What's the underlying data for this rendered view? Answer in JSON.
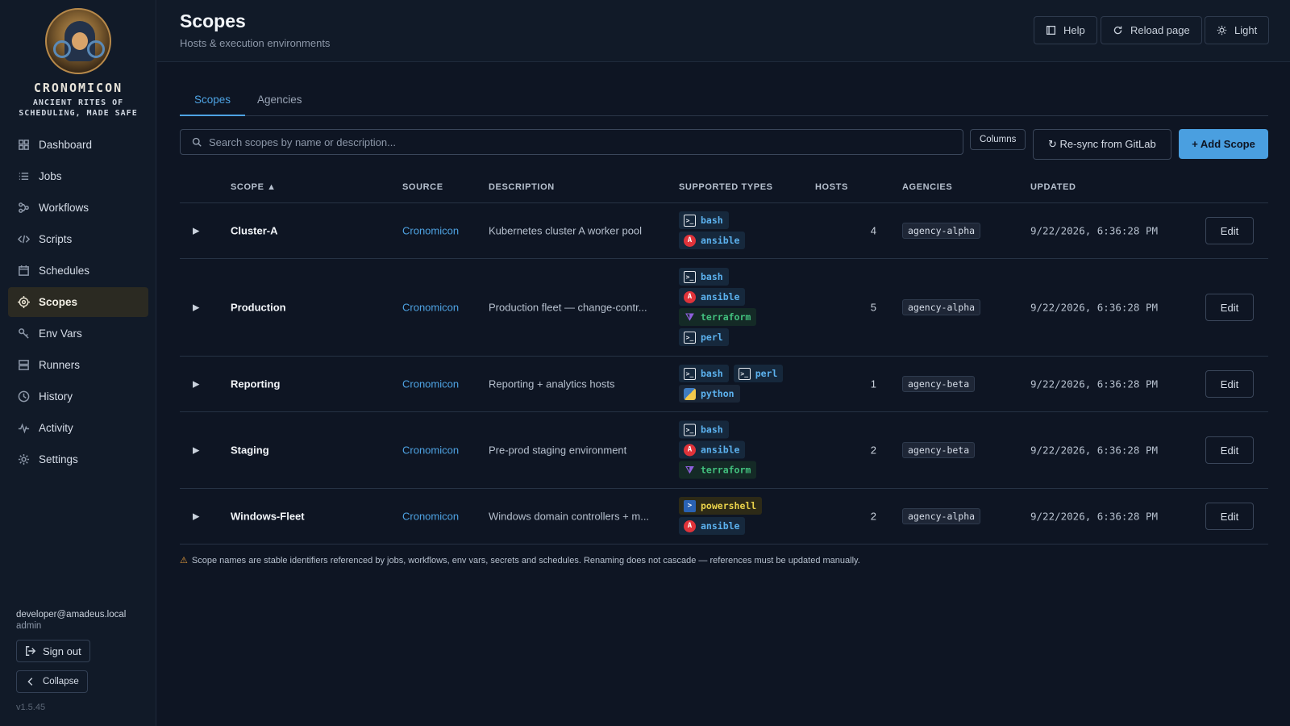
{
  "app": {
    "name": "CRONOMICON",
    "tagline": "ANCIENT RITES OF SCHEDULING, MADE SAFE",
    "version": "v1.5.45"
  },
  "sidebar": {
    "items": [
      {
        "label": "Dashboard",
        "icon": "dashboard-icon"
      },
      {
        "label": "Jobs",
        "icon": "list-icon"
      },
      {
        "label": "Workflows",
        "icon": "workflow-icon"
      },
      {
        "label": "Scripts",
        "icon": "code-icon"
      },
      {
        "label": "Schedules",
        "icon": "calendar-icon"
      },
      {
        "label": "Scopes",
        "icon": "target-icon",
        "active": true
      },
      {
        "label": "Env Vars",
        "icon": "key-icon"
      },
      {
        "label": "Runners",
        "icon": "server-icon"
      },
      {
        "label": "History",
        "icon": "clock-icon"
      },
      {
        "label": "Activity",
        "icon": "pulse-icon"
      },
      {
        "label": "Settings",
        "icon": "gear-icon"
      }
    ],
    "user_email": "developer@amadeus.local",
    "user_role": "admin",
    "signout_label": "Sign out",
    "collapse_label": "Collapse"
  },
  "header": {
    "title": "Scopes",
    "subtitle": "Hosts & execution environments",
    "help_label": "Help",
    "reload_label": "Reload page",
    "theme_label": "Light"
  },
  "tabs": [
    {
      "label": "Scopes",
      "active": true
    },
    {
      "label": "Agencies",
      "active": false
    }
  ],
  "toolbar": {
    "search_placeholder": "Search scopes by name or description...",
    "columns_label": "Columns",
    "resync_label": "↻ Re-sync from GitLab",
    "add_label": "+ Add Scope"
  },
  "table": {
    "columns": [
      "SCOPE ▲",
      "SOURCE",
      "DESCRIPTION",
      "SUPPORTED TYPES",
      "HOSTS",
      "AGENCIES",
      "UPDATED"
    ],
    "edit_label": "Edit",
    "expander": "▶",
    "rows": [
      {
        "name": "Cluster-A",
        "source": "Cronomicon",
        "description": "Kubernetes cluster A worker pool",
        "types": [
          [
            "bash"
          ],
          [
            "ansible"
          ]
        ],
        "hosts": "4",
        "agency": "agency-alpha",
        "updated": "9/22/2026, 6:36:28 PM"
      },
      {
        "name": "Production",
        "source": "Cronomicon",
        "description": "Production fleet — change-contr...",
        "types": [
          [
            "bash"
          ],
          [
            "ansible"
          ],
          [
            "terraform"
          ],
          [
            "perl"
          ]
        ],
        "hosts": "5",
        "agency": "agency-alpha",
        "updated": "9/22/2026, 6:36:28 PM"
      },
      {
        "name": "Reporting",
        "source": "Cronomicon",
        "description": "Reporting + analytics hosts",
        "types": [
          [
            "bash",
            "perl"
          ],
          [
            "python"
          ]
        ],
        "hosts": "1",
        "agency": "agency-beta",
        "updated": "9/22/2026, 6:36:28 PM"
      },
      {
        "name": "Staging",
        "source": "Cronomicon",
        "description": "Pre-prod staging environment",
        "types": [
          [
            "bash"
          ],
          [
            "ansible"
          ],
          [
            "terraform"
          ]
        ],
        "hosts": "2",
        "agency": "agency-beta",
        "updated": "9/22/2026, 6:36:28 PM"
      },
      {
        "name": "Windows-Fleet",
        "source": "Cronomicon",
        "description": "Windows domain controllers + m...",
        "types": [
          [
            "powershell"
          ],
          [
            "ansible"
          ]
        ],
        "hosts": "2",
        "agency": "agency-alpha",
        "updated": "9/22/2026, 6:36:28 PM"
      }
    ]
  },
  "footer_note": "Scope names are stable identifiers referenced by jobs, workflows, env vars, secrets and schedules. Renaming does not cascade — references must be updated manually.",
  "colors": {
    "accent": "#4a9fe0",
    "background": "#0e1523",
    "sidebar_bg": "#111a28",
    "active_nav": "#2b2a22",
    "warning": "#e39a3b"
  }
}
